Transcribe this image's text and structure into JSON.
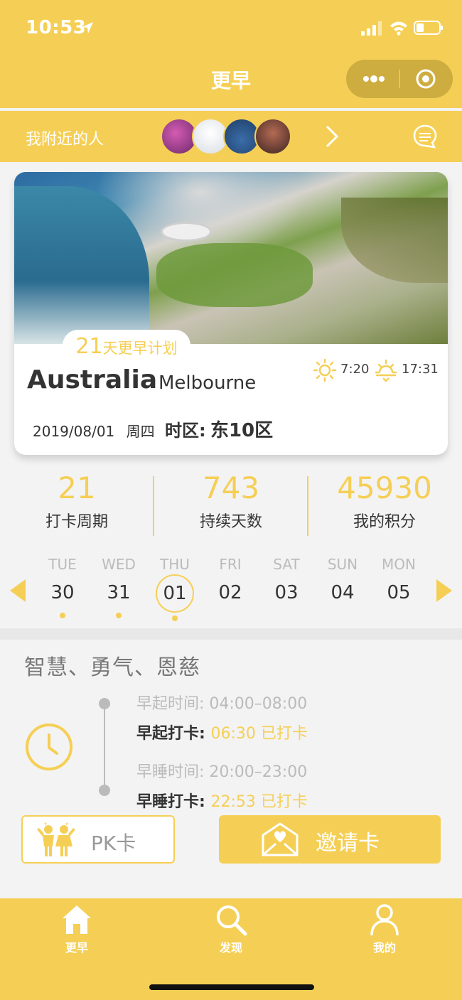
{
  "status_bar": {
    "time": "10:53"
  },
  "header": {
    "title": "更早"
  },
  "nearby": {
    "label": "我附近的人"
  },
  "card": {
    "plan_number": "21",
    "plan_text": "天更早计划",
    "country": "Australia",
    "city": "Melbourne",
    "sunrise": "7:20",
    "sunset": "17:31",
    "date": "2019/08/01",
    "weekday": "周四",
    "timezone_label": "时区:",
    "timezone_value": "东10区"
  },
  "stats": [
    {
      "value": "21",
      "label": "打卡周期"
    },
    {
      "value": "743",
      "label": "持续天数"
    },
    {
      "value": "45930",
      "label": "我的积分"
    }
  ],
  "week": [
    {
      "name": "TUE",
      "date": "30"
    },
    {
      "name": "WED",
      "date": "31"
    },
    {
      "name": "THU",
      "date": "01"
    },
    {
      "name": "FRI",
      "date": "02"
    },
    {
      "name": "SAT",
      "date": "03"
    },
    {
      "name": "SUN",
      "date": "04"
    },
    {
      "name": "MON",
      "date": "05"
    }
  ],
  "motto": "智慧、勇气、恩慈",
  "records": {
    "wake_window": "早起时间: 04:00–08:00",
    "wake_label": "早起打卡:",
    "wake_value": "06:30 已打卡",
    "sleep_window": "早睡时间: 20:00–23:00",
    "sleep_label": "早睡打卡:",
    "sleep_value": "22:53 已打卡"
  },
  "buttons": {
    "pk": "PK卡",
    "invite": "邀请卡"
  },
  "tabs": [
    {
      "label": "更早",
      "icon": "home-icon"
    },
    {
      "label": "发现",
      "icon": "search-icon"
    },
    {
      "label": "我的",
      "icon": "user-icon"
    }
  ],
  "colors": {
    "accent": "#f5cf55",
    "background": "#f3f3f3"
  }
}
